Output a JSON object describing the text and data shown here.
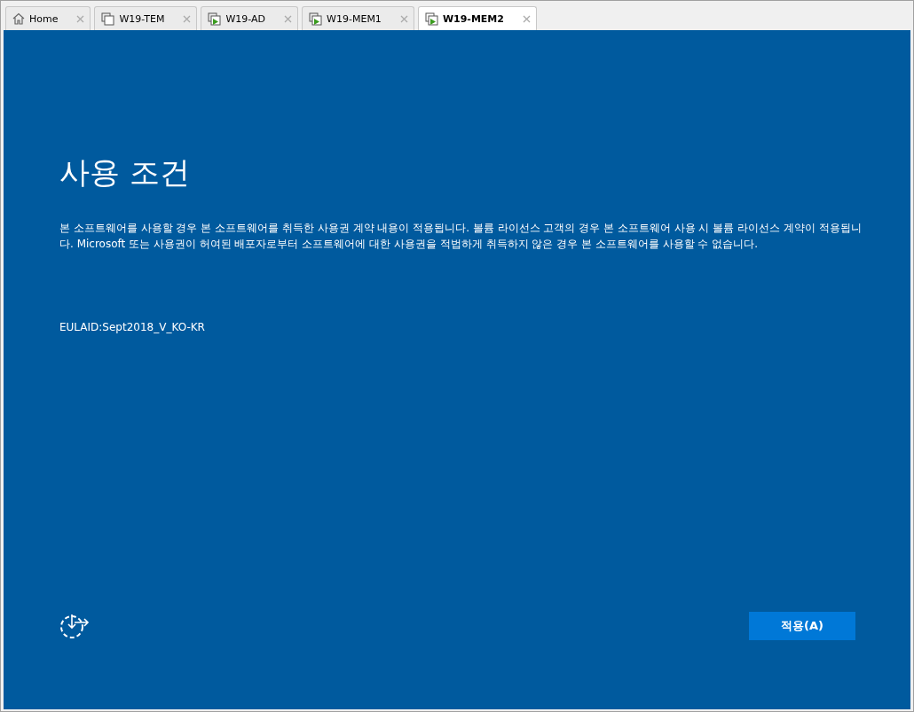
{
  "tabs": [
    {
      "label": "Home",
      "kind": "home",
      "selected": false
    },
    {
      "label": "W19-TEM",
      "kind": "vm",
      "selected": false
    },
    {
      "label": "W19-AD",
      "kind": "vm-running",
      "selected": false
    },
    {
      "label": "W19-MEM1",
      "kind": "vm-running",
      "selected": false
    },
    {
      "label": "W19-MEM2",
      "kind": "vm-running",
      "selected": true
    }
  ],
  "screen": {
    "title": "사용 조건",
    "body": "본 소프트웨어를 사용할 경우 본 소프트웨어를 취득한 사용권 계약 내용이 적용됩니다. 볼륨 라이선스 고객의 경우 본 소프트웨어 사용 시 볼륨 라이선스 계약이 적용됩니다. Microsoft 또는 사용권이 허여된 배포자로부터 소프트웨어에 대한 사용권을 적법하게 취득하지 않은 경우 본 소프트웨어를 사용할 수 없습니다.",
    "eula_id": "EULAID:Sept2018_V_KO-KR",
    "accept_button": "적용(A)"
  }
}
